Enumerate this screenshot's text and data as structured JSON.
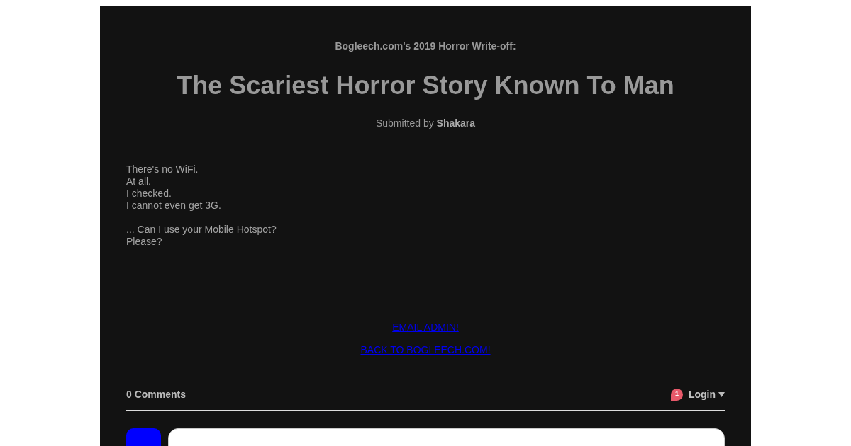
{
  "header": {
    "event": "Bogleech.com's 2019 Horror Write-off:",
    "title": "The Scariest Horror Story Known To Man",
    "byline": "Submitted by **Shakara**"
  },
  "story": {
    "paragraphs": [
      [
        "There's no WiFi.",
        "At all.",
        "I checked.",
        "I cannot even get 3G."
      ],
      [
        "... Can I use your Mobile Hotspot?",
        "Please?"
      ]
    ]
  },
  "links": [
    "EMAIL ADMIN!",
    "BACK TO BOGLEECH.COM!"
  ],
  "comments": {
    "count_label": "0 Comments",
    "notifications": "1",
    "login": "Login"
  }
}
